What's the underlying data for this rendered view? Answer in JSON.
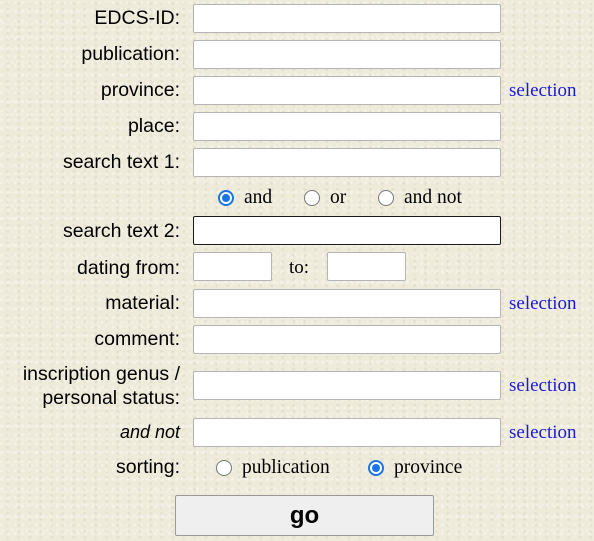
{
  "form": {
    "labels": {
      "edcs_id": "EDCS-ID:",
      "publication": "publication:",
      "province": "province:",
      "place": "place:",
      "search_text_1": "search text 1:",
      "search_text_2": "search text 2:",
      "dating_from": "dating from:",
      "dating_to": "to:",
      "material": "material:",
      "comment": "comment:",
      "genus_line1": "inscription genus /",
      "genus_line2": "personal status:",
      "and_not": "and not",
      "sorting": "sorting:"
    },
    "values": {
      "edcs_id": "",
      "publication": "",
      "province": "",
      "place": "",
      "search_text_1": "",
      "search_text_2": "",
      "dating_from": "",
      "dating_to": "",
      "material": "",
      "comment": "",
      "genus": "",
      "and_not": ""
    },
    "selection_link": "selection",
    "operator": {
      "options": [
        "and",
        "or",
        "and not"
      ],
      "selected": "and"
    },
    "sorting": {
      "options": [
        "publication",
        "province"
      ],
      "selected": "province"
    },
    "submit_label": "go",
    "colors": {
      "link": "#1a1ad8",
      "radio_accent": "#1a73e8",
      "background": "#efebdb"
    }
  }
}
